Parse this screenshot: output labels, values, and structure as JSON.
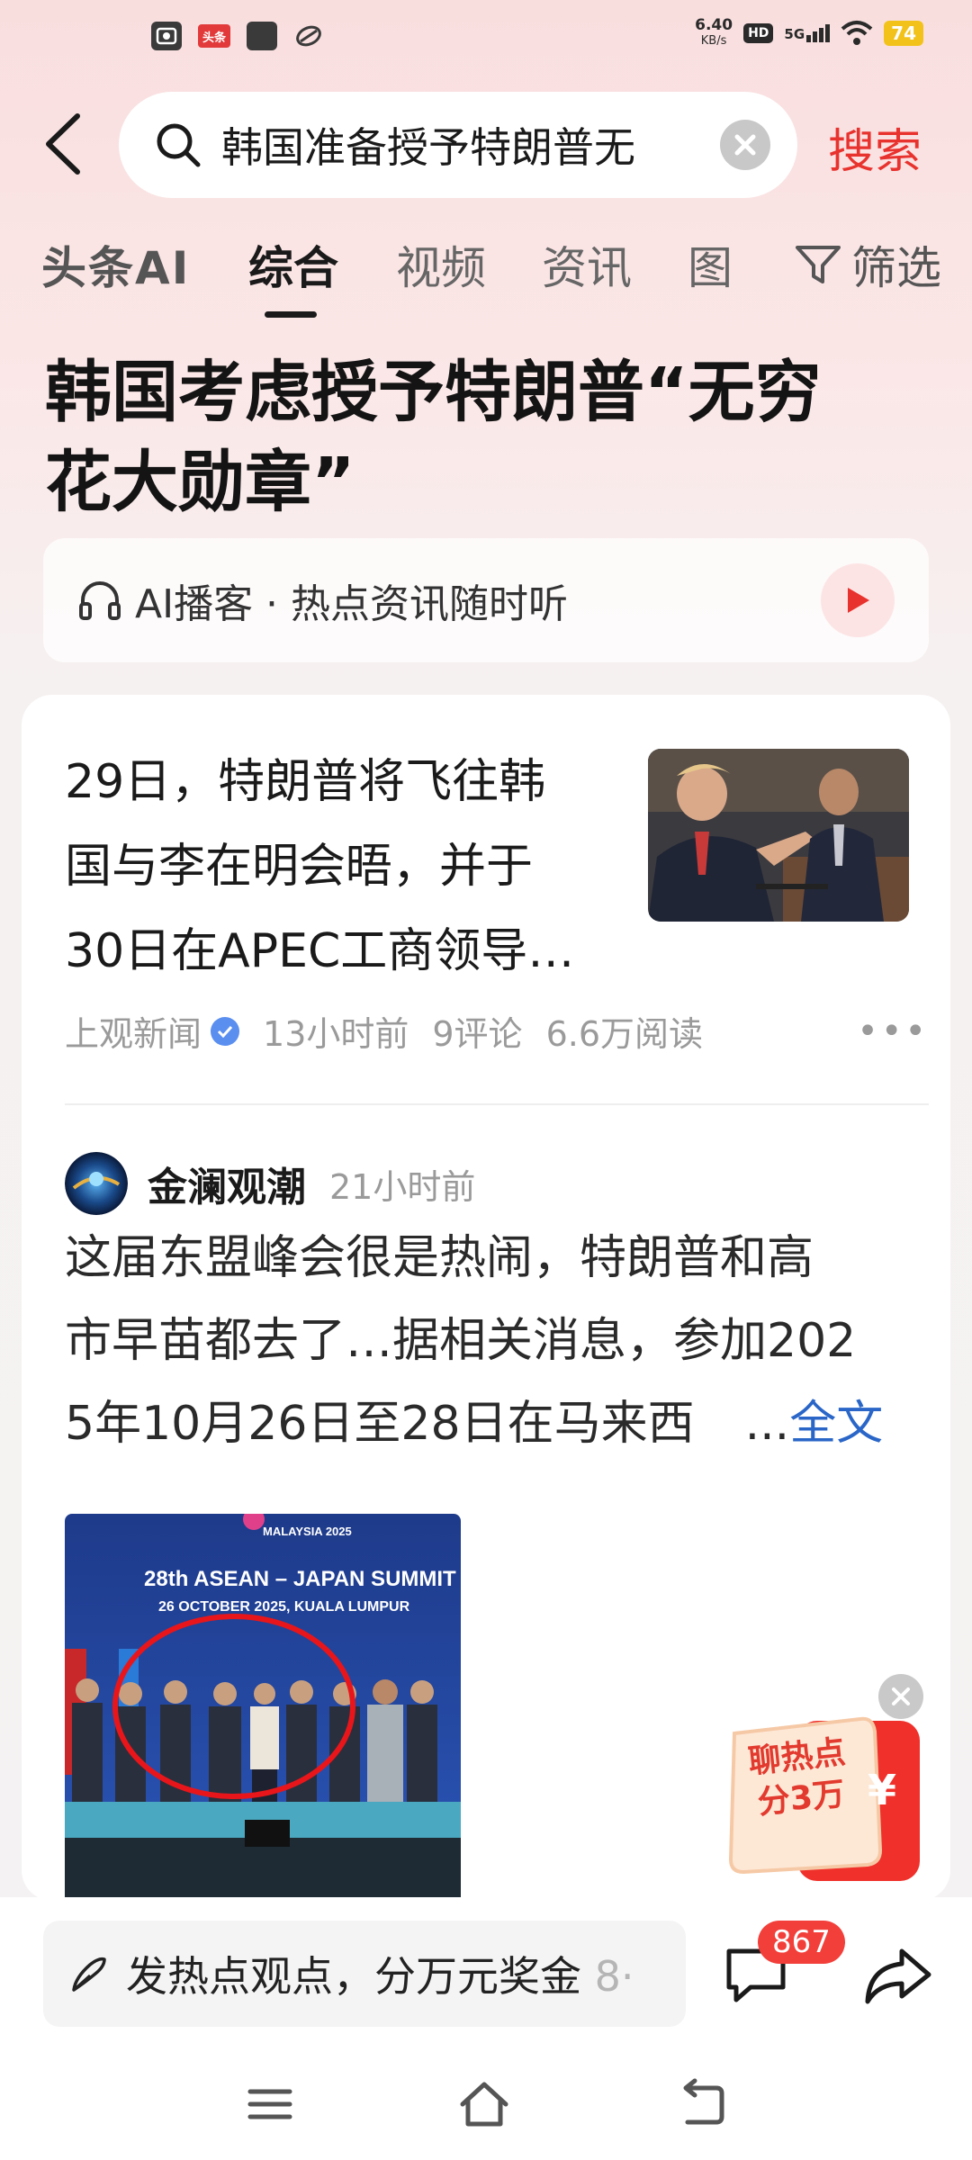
{
  "status_bar": {
    "badge_label": "头条",
    "speed_value": "6.40",
    "speed_unit": "KB/s",
    "hd_label": "HD",
    "network_label": "5G",
    "battery_level": "74",
    "battery_color": "#f2c21b"
  },
  "search": {
    "query": "韩国准备授予特朗普无",
    "submit_label": "搜索",
    "accent_color": "#e8322e"
  },
  "tabs": {
    "ai_label": "头条AI",
    "items": [
      "综合",
      "视频",
      "资讯",
      "图"
    ],
    "active_index": 0,
    "filter_label": "筛选"
  },
  "headline": {
    "line1": "韩国考虑授予特朗普“无穷",
    "line2": "花大勋章”"
  },
  "podcast": {
    "label": "AI播客 · 热点资讯随时听"
  },
  "news_item": {
    "title_line1": "29日，特朗普将飞往韩",
    "title_line2": "国与李在明会晤，并于",
    "title_line3": "30日在APEC工商领导…",
    "source": "上观新闻",
    "time": "13小时前",
    "comments": "9评论",
    "reads": "6.6万阅读",
    "more_icon": "more-icon"
  },
  "post": {
    "author": "金澜观潮",
    "time": "21小时前",
    "text_line1": "这届东盟峰会很是热闹，特朗普和高",
    "text_line2": "市早苗都去了…据相关消息，参加202",
    "text_line3": "5年10月26日至28日在马来西",
    "ellipsis": "...",
    "full_text_label": "全文",
    "image_banner_top": "MALAYSIA 2025",
    "image_banner_title": "28th ASEAN – JAPAN SUMMIT",
    "image_banner_sub": "26 OCTOBER 2025, KUALA LUMPUR"
  },
  "promo": {
    "line1": "聊热点",
    "line2": "分3万",
    "yen": "¥"
  },
  "bottom_bar": {
    "comment_prompt": "发热点观点，分万元奖金",
    "comment_prompt_trail": "8·",
    "comment_count": "867"
  }
}
